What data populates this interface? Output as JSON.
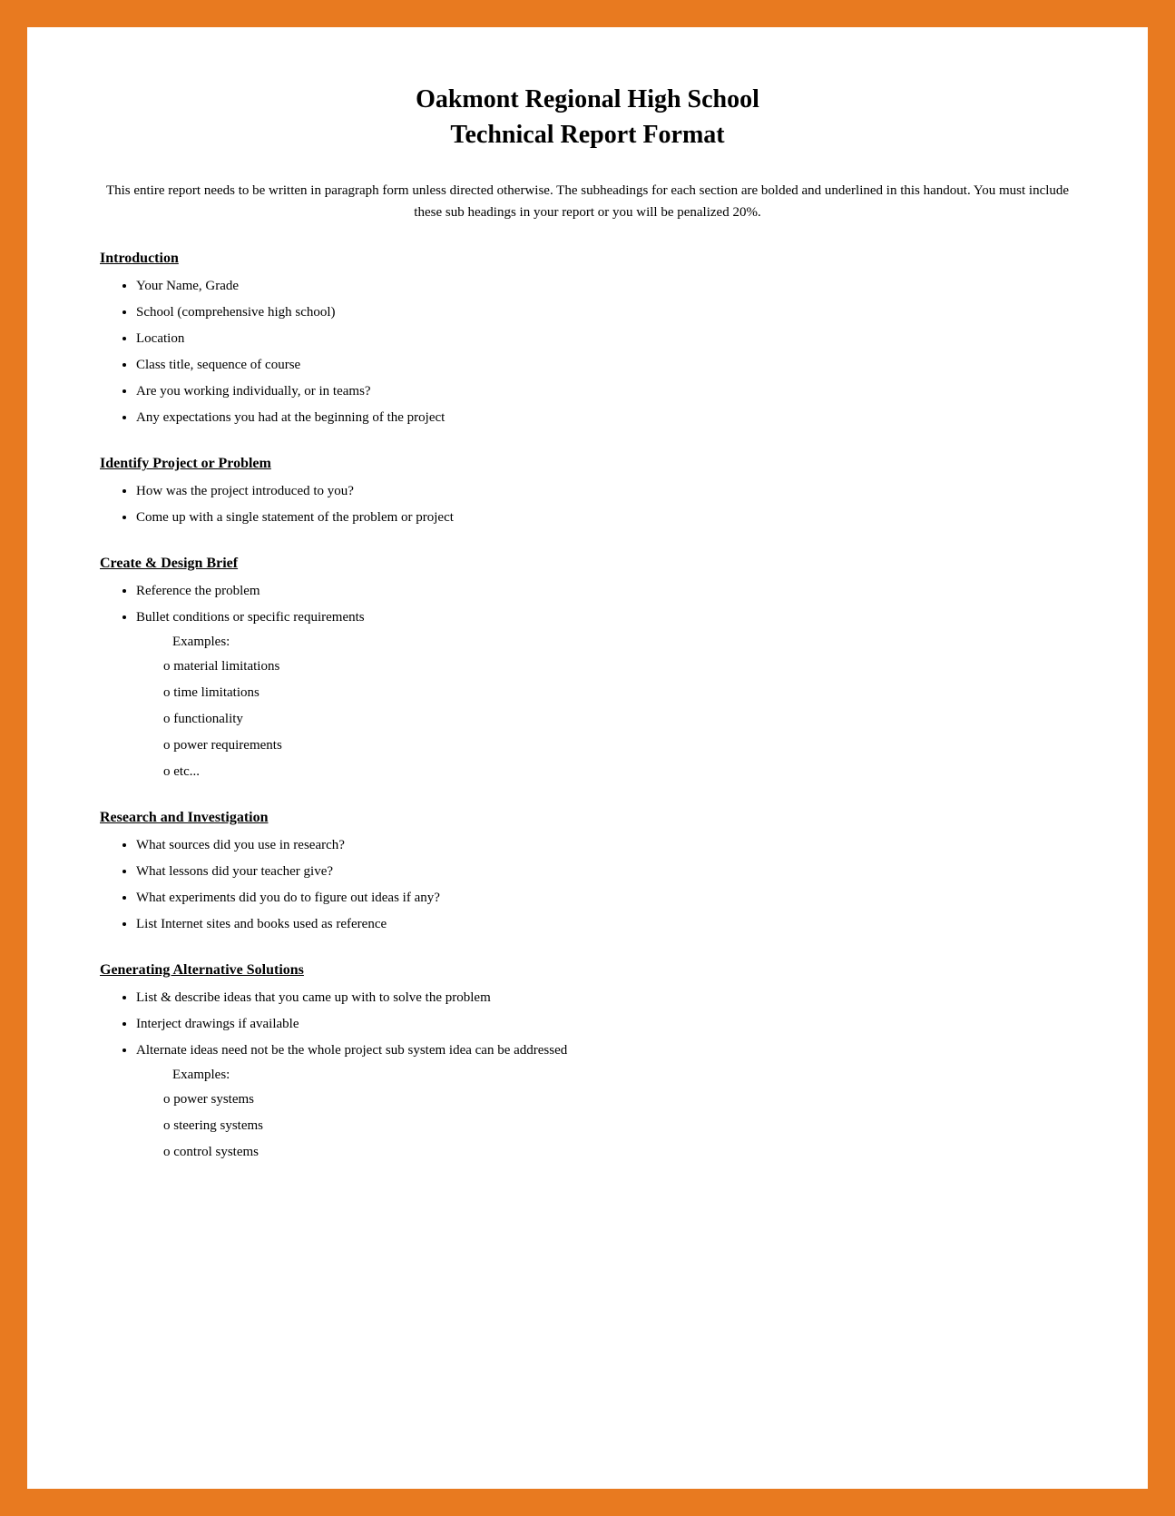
{
  "document": {
    "title_line1": "Oakmont Regional High School",
    "title_line2": "Technical Report Format",
    "intro": "This entire report needs to be written in paragraph form unless directed otherwise. The subheadings for each section are bolded and underlined in this handout. You must include these sub headings in your report or you will be penalized 20%.",
    "sections": [
      {
        "id": "introduction",
        "heading": "Introduction",
        "bullets": [
          "Your Name, Grade",
          "School (comprehensive high school)",
          "Location",
          "Class title, sequence of course",
          "Are you working individually, or in teams?",
          "Any expectations you had at the beginning of the project"
        ],
        "sub_items": [],
        "examples": []
      },
      {
        "id": "identify-project",
        "heading": "Identify Project or Problem",
        "bullets": [
          "How was the project introduced to you?",
          "Come up with a single statement of the problem or project"
        ],
        "sub_items": [],
        "examples": []
      },
      {
        "id": "create-design-brief",
        "heading": "Create & Design Brief",
        "bullets": [
          "Reference the problem",
          "Bullet conditions or specific requirements"
        ],
        "examples_label": "Examples:",
        "sub_items": [
          "material limitations",
          "time limitations",
          "functionality",
          "power requirements",
          "etc..."
        ]
      },
      {
        "id": "research-investigation",
        "heading": "Research and Investigation",
        "bullets": [
          "What sources did you use in research?",
          "What lessons did your teacher give?",
          "What experiments did you do to figure out ideas if any?",
          "List Internet sites and books used as reference"
        ],
        "sub_items": [],
        "examples": []
      },
      {
        "id": "generating-alternative-solutions",
        "heading": "Generating Alternative Solutions",
        "bullets": [
          "List & describe ideas that you came up with to solve the problem",
          "Interject drawings if available",
          "Alternate ideas need not be the whole project sub system idea can be addressed"
        ],
        "examples_label": "Examples:",
        "sub_items": [
          "power systems",
          "steering systems",
          "control systems"
        ]
      }
    ]
  }
}
